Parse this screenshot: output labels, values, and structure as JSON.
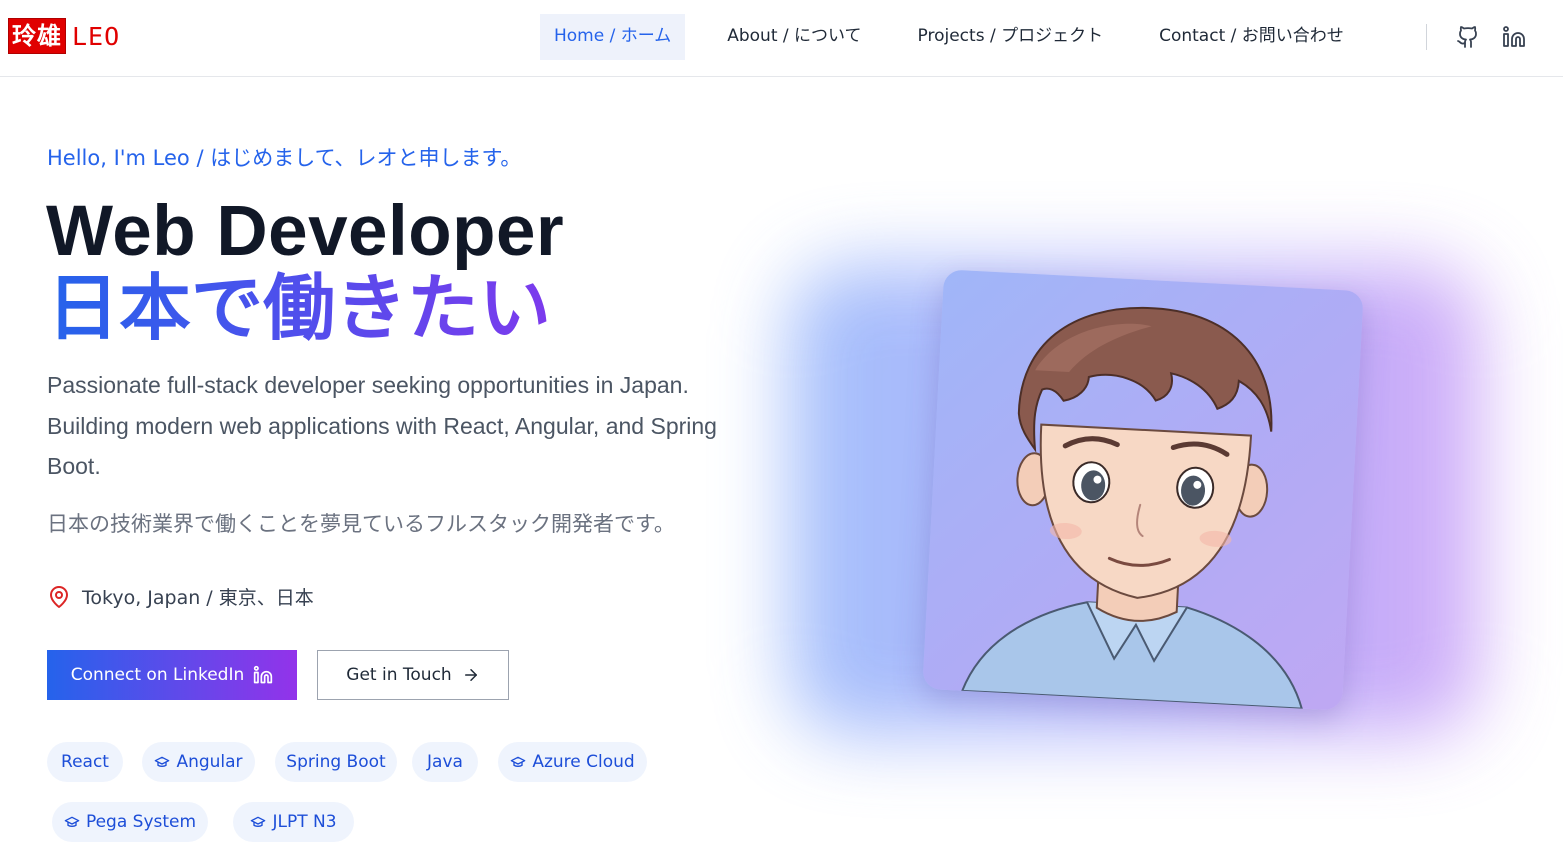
{
  "brand": {
    "kanji": "玲雄",
    "name": "LEO",
    "color": "#e00000"
  },
  "nav": {
    "items": [
      {
        "label": "Home / ホーム",
        "active": true
      },
      {
        "label": "About / について",
        "active": false
      },
      {
        "label": "Projects / プロジェクト",
        "active": false
      },
      {
        "label": "Contact / お問い合わせ",
        "active": false
      }
    ],
    "icons": [
      "github-icon",
      "linkedin-icon"
    ]
  },
  "hero": {
    "greeting": "Hello, I'm Leo / はじめまして、レオと申します。",
    "title": "Web Developer",
    "title_jp": "日本で働きたい",
    "description": "Passionate full-stack developer seeking opportunities in Japan. Building modern web applications with React, Angular, and Spring Boot.",
    "description_jp": "日本の技術業界で働くことを夢見ているフルスタック開発者です。",
    "location": "Tokyo, Japan / 東京、日本",
    "primary_button": "Connect on LinkedIn",
    "secondary_button": "Get in Touch"
  },
  "tags": [
    {
      "label": "React",
      "icon": null
    },
    {
      "label": "Angular",
      "icon": "graduation-cap-icon"
    },
    {
      "label": "Spring Boot",
      "icon": null
    },
    {
      "label": "Java",
      "icon": null
    },
    {
      "label": "Azure Cloud",
      "icon": "graduation-cap-icon"
    },
    {
      "label": "Pega System",
      "icon": "graduation-cap-icon"
    },
    {
      "label": "JLPT N3",
      "icon": "graduation-cap-icon"
    }
  ],
  "colors": {
    "accent": "#2563eb",
    "gradient_end": "#9333ea",
    "tag_bg": "#eff4fd"
  }
}
